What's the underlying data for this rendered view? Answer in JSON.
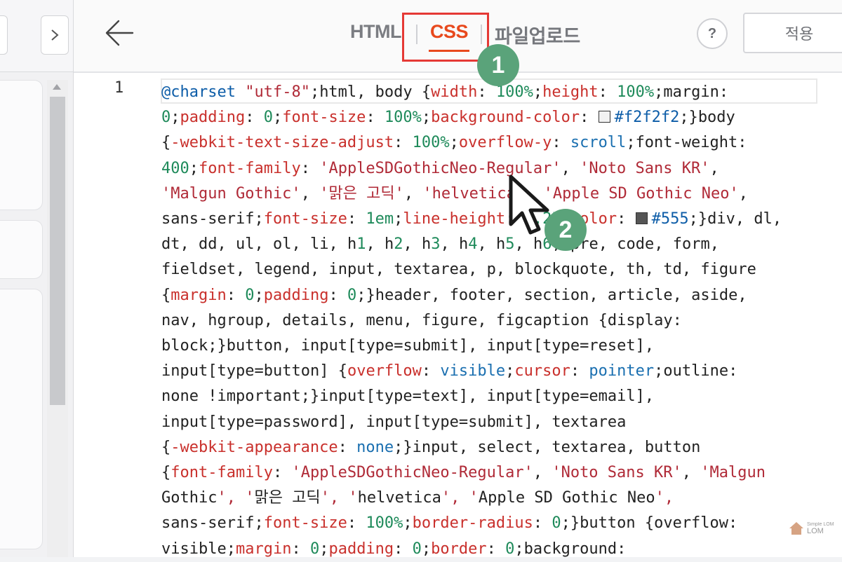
{
  "tabs": [
    {
      "label": "HTML"
    },
    {
      "label": "CSS"
    },
    {
      "label": "파일업로드"
    }
  ],
  "help_label": "?",
  "apply_label": "적용",
  "line_number": "1",
  "annotations": {
    "badge1": "1",
    "badge2": "2"
  },
  "watermark": {
    "top": "Simple LOM",
    "brand": "LOM"
  },
  "code_text": "@charset \"utf-8\";html, body {width: 100%;height: 100%;margin: 0;padding: 0;font-size: 100%;background-color: #f2f2f2;}body {-webkit-text-size-adjust: 100%;overflow-y: scroll;font-weight: 400;font-family: 'AppleSDGothicNeo-Regular', 'Noto Sans KR', 'Malgun Gothic', '맑은 고딕', 'helvetica', 'Apple SD Gothic Neo', sans-serif;font-size: 1em;line-height: 1.25;color: #555;}div, dl, dt, dd, ul, ol, li, h1, h2, h3, h4, h5, h6, pre, code, form, fieldset, legend, input, textarea, p, blockquote, th, td, figure {margin: 0;padding: 0;}header, footer, section, article, aside, nav, hgroup, details, menu, figure, figcaption {display: block;}button, input[type=submit], input[type=reset], input[type=button] {overflow: visible;cursor: pointer;outline: none !important;}input[type=text], input[type=email], input[type=password], input[type=submit], textarea {-webkit-appearance: none;}input, select, textarea, button {font-family: 'AppleSDGothicNeo-Regular', 'Noto Sans KR', 'Malgun Gothic', '맑은 고딕', 'helvetica', 'Apple SD Gothic Neo', sans-serif;font-size: 100%;border-radius: 0;}button {overflow: visible;margin: 0;padding: 0;border: 0;background:",
  "colors": {
    "accent": "#e8491d",
    "highlight": "#e53935",
    "badge": "#5aa37a",
    "swatch1": "#f2f2f2",
    "swatch2": "#555555"
  }
}
